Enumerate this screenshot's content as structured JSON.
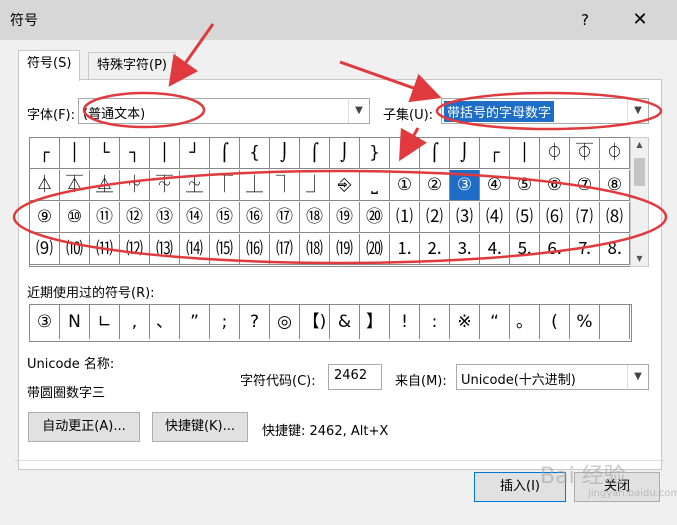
{
  "window": {
    "title": "符号",
    "help_glyph": "?",
    "close_glyph": "✕"
  },
  "tabs": [
    {
      "label": "符号(S)",
      "active": true
    },
    {
      "label": "特殊字符(P)",
      "active": false
    }
  ],
  "font": {
    "label": "字体(F):",
    "value": "(普通文本)"
  },
  "subset": {
    "label": "子集(U):",
    "value": "带括号的字母数字"
  },
  "symbol_grid": {
    "rows": [
      [
        "┌",
        "│",
        "└",
        "┐",
        "│",
        "┘",
        "⌠",
        "{",
        "⌡",
        "⌠",
        "⌡",
        "}",
        "↙",
        "⌠",
        "⌡",
        "┌",
        "│",
        "⏀",
        "⏁",
        "⏀"
      ],
      [
        "⏃",
        "⏄",
        "⏅",
        "⏆",
        "⏇",
        "⏈",
        "⏉",
        "⏊",
        "⏋",
        "⏌",
        "⎆",
        "⎵",
        "①",
        "②",
        "③",
        "④",
        "⑤",
        "⑥",
        "⑦",
        "⑧"
      ],
      [
        "⑨",
        "⑩",
        "⑪",
        "⑫",
        "⑬",
        "⑭",
        "⑮",
        "⑯",
        "⑰",
        "⑱",
        "⑲",
        "⑳",
        "⑴",
        "⑵",
        "⑶",
        "⑷",
        "⑸",
        "⑹",
        "⑺",
        "⑻"
      ],
      [
        "⑼",
        "⑽",
        "⑾",
        "⑿",
        "⒀",
        "⒁",
        "⒂",
        "⒃",
        "⒄",
        "⒅",
        "⒆",
        "⒇",
        "⒈",
        "⒉",
        "⒊",
        "⒋",
        "⒌",
        "⒍",
        "⒎",
        "⒏"
      ]
    ],
    "selected": {
      "row": 1,
      "col": 14
    }
  },
  "recent": {
    "label": "近期使用过的符号(R):",
    "symbols": [
      "③",
      "N",
      "∟",
      ",",
      "、",
      "”",
      ";",
      "?",
      "◎",
      "【)",
      "&",
      "】",
      "!",
      ":",
      "※",
      "“",
      "。",
      "(",
      "%",
      ""
    ]
  },
  "unicode": {
    "name_label": "Unicode 名称:",
    "name_value": "带圆圈数字三"
  },
  "char_code": {
    "label": "字符代码(C):",
    "value": "2462"
  },
  "from": {
    "label": "来自(M):",
    "value": "Unicode(十六进制)"
  },
  "buttons": {
    "autocorrect": "自动更正(A)...",
    "shortcut_key": "快捷键(K)...",
    "insert": "插入(I)",
    "close": "关闭"
  },
  "shortcut_info": "快捷键: 2462, Alt+X",
  "watermark": {
    "line1": "Bai 经验",
    "line2": "jingyan.baidu.com"
  },
  "annotation_color": "#e03a3e"
}
